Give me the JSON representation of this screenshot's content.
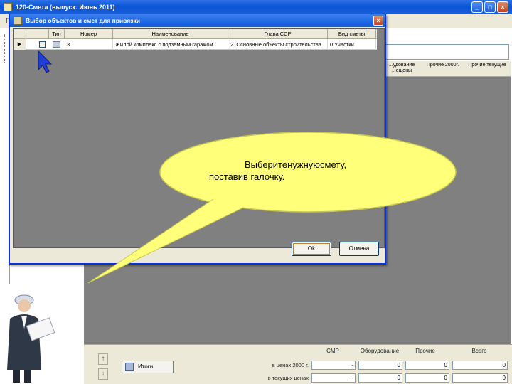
{
  "app": {
    "title": "120-Смета (выпуск: Июнь 2011)",
    "menu_label": "Г"
  },
  "main_grid": {
    "headers": [
      "...удование ...ещены",
      "Прочие 2000г.",
      "Прочие текущие"
    ]
  },
  "dialog": {
    "title": "Выбор объектов и смет для привязки",
    "columns": [
      "Тип",
      "Номер",
      "Наименование",
      "Глава ССР",
      "Вид сметы"
    ],
    "row": {
      "indicator": "▶",
      "number": "3",
      "name": "Жилой комплекс с подземным гаражом",
      "chapter": "2. Основные объекты строительства",
      "kind": "0 Участки"
    },
    "ok_label": "Ok",
    "cancel_label": "Отмена"
  },
  "totals": {
    "button_label": "Итоги",
    "headers": [
      "СМР",
      "Оборудование",
      "Прочие",
      "Всего"
    ],
    "row_labels": [
      "в ценах 2000 г.",
      "в текущих ценах"
    ],
    "rows": [
      [
        "-",
        "0",
        "0",
        "0"
      ],
      [
        "-",
        "0",
        "0",
        "0"
      ]
    ]
  },
  "callout": {
    "line1": "Выберитенужнуюсмету,",
    "line2": "поставив галочку."
  },
  "colors": {
    "titlebar": "#0a54d6",
    "grid_bg": "#808080",
    "bubble_fill": "#ffff7a"
  }
}
